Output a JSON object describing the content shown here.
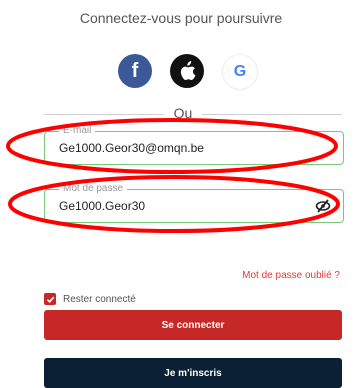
{
  "header": {
    "title": "Connectez-vous pour poursuivre"
  },
  "social": [
    {
      "name": "facebook-login-button",
      "icon": "facebook-icon",
      "glyph": "f",
      "color": "#3b5998"
    },
    {
      "name": "apple-login-button",
      "icon": "apple-icon",
      "glyph": "",
      "color": "#111111"
    },
    {
      "name": "google-login-button",
      "icon": "google-icon",
      "glyph": "G",
      "color": "#4285f4"
    }
  ],
  "divider": {
    "label": "Ou"
  },
  "form": {
    "email": {
      "label": "E-mail",
      "value": "Ge1000.Geor30@omqn.be"
    },
    "password": {
      "label": "Mot de passe",
      "value": "Ge1000.Geor30",
      "toggle_icon": "eye-off-icon"
    },
    "forgot_label": "Mot de passe oublié ?",
    "remember": {
      "label": "Rester connecté",
      "checked": true
    },
    "login_label": "Se connecter",
    "signup_label": "Je m'inscris"
  },
  "colors": {
    "accent": "#c62828",
    "dark": "#0b2035",
    "field_border": "#79c879",
    "link": "#e53935",
    "annotation": "#ff0000"
  }
}
